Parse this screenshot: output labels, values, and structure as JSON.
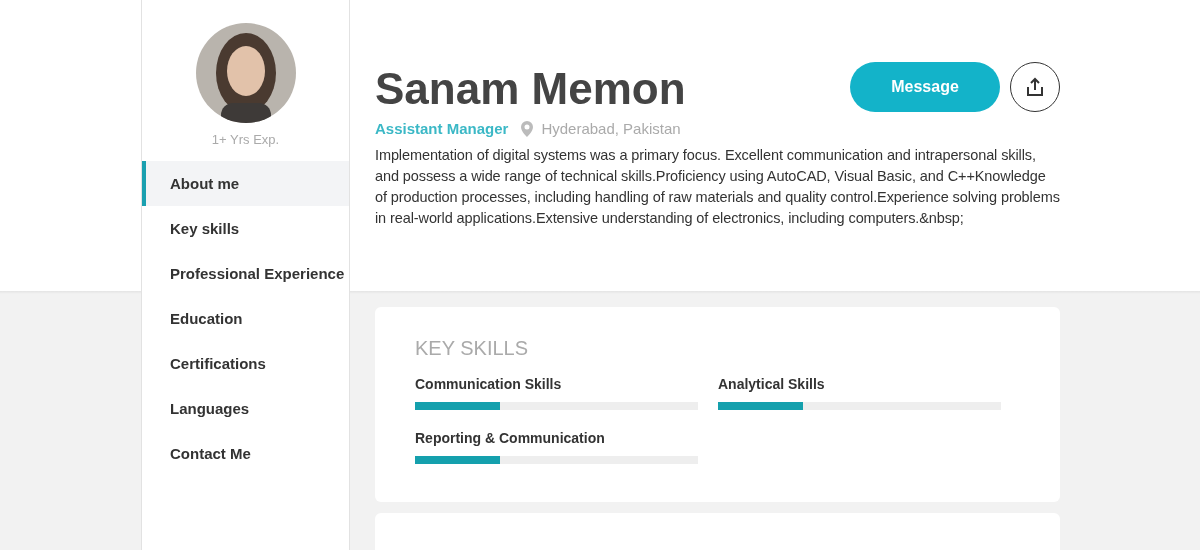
{
  "profile": {
    "experience": "1+ Yrs Exp.",
    "name": "Sanam Memon",
    "title": "Assistant Manager",
    "location": "Hyderabad, Pakistan",
    "about": "Implementation of digital systems was a primary focus. Excellent communication and intrapersonal skills, and possess a wide range of technical skills.Proficiency using AutoCAD, Visual Basic, and C++Knowledge of production processes, including handling of raw materials and quality control.Experience solving problems in real-world applications.Extensive understanding of electronics, including computers.&nbsp;"
  },
  "actions": {
    "message": "Message"
  },
  "sidebar": {
    "items": [
      {
        "label": "About me",
        "selected": true
      },
      {
        "label": "Key skills",
        "selected": false
      },
      {
        "label": "Professional Experience",
        "selected": false
      },
      {
        "label": "Education",
        "selected": false
      },
      {
        "label": "Certifications",
        "selected": false
      },
      {
        "label": "Languages",
        "selected": false
      },
      {
        "label": "Contact Me",
        "selected": false
      }
    ]
  },
  "key_skills": {
    "title": "KEY SKILLS",
    "skills": [
      {
        "name": "Communication Skills",
        "level": 0.3
      },
      {
        "name": "Analytical Skills",
        "level": 0.3
      },
      {
        "name": "Reporting & Communication",
        "level": 0.3
      }
    ]
  }
}
